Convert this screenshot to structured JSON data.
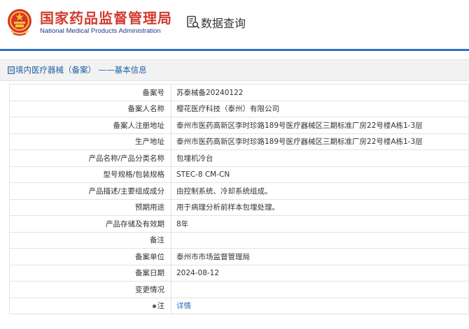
{
  "header": {
    "title_cn": "国家药品监督管理局",
    "title_en": "National Medical Products Administration",
    "query_label": "数据查询",
    "brand_red": "#d23b30",
    "brand_blue": "#2e6fc4"
  },
  "nav": {
    "icon": "document-icon",
    "breadcrumb": "境内医疗器械（备案） ——基本信息"
  },
  "record": {
    "rows": [
      {
        "label": "备案号",
        "value": "苏泰械备20240122"
      },
      {
        "label": "备案人名称",
        "value": "樱花医疗科技（泰州）有限公司"
      },
      {
        "label": "备案人注册地址",
        "value": "泰州市医药高新区李时珍路189号医疗器械区三期标准厂房22号楼A栋1-3层"
      },
      {
        "label": "生产地址",
        "value": "泰州市医药高新区李时珍路189号医疗器械区三期标准厂房22号楼A栋1-3层"
      },
      {
        "label": "产品名称/产品分类名称",
        "value": "包埋机冷台"
      },
      {
        "label": "型号规格/包装规格",
        "value": "STEC-8 CM-CN"
      },
      {
        "label": "产品描述/主要组成成分",
        "value": "由控制系统、冷却系统组成。"
      },
      {
        "label": "预期用途",
        "value": "用于病理分析前样本包埋处理。"
      },
      {
        "label": "产品存储及有效期",
        "value": "8年"
      },
      {
        "label": "备注",
        "value": ""
      },
      {
        "label": "备案单位",
        "value": "泰州市市场监督管理局"
      },
      {
        "label": "备案日期",
        "value": "2024-08-12"
      },
      {
        "label": "变更情况",
        "value": ""
      },
      {
        "label": "注",
        "value": "详情"
      }
    ]
  }
}
